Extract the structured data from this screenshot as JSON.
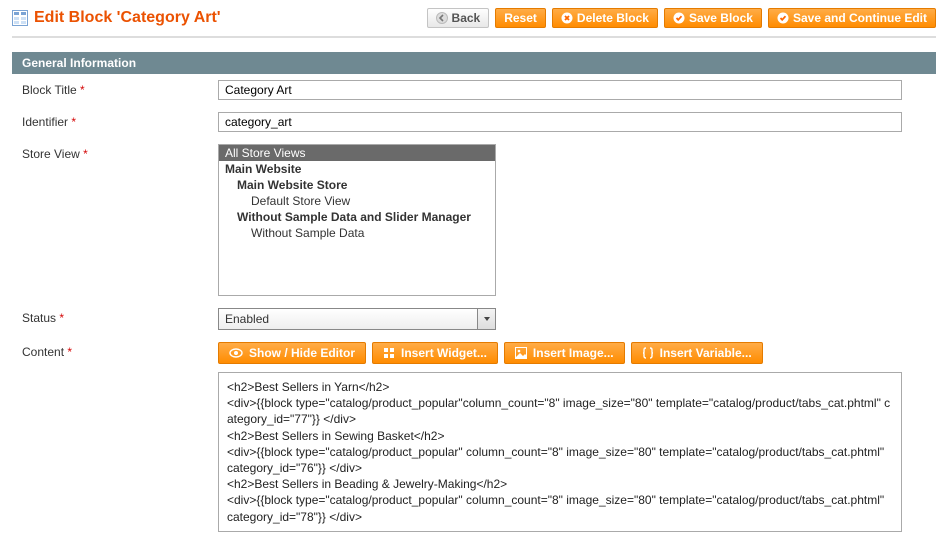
{
  "header": {
    "title": "Edit Block 'Category Art'",
    "buttons": {
      "back": "Back",
      "reset": "Reset",
      "delete": "Delete Block",
      "save": "Save Block",
      "save_continue": "Save and Continue Edit"
    }
  },
  "section": {
    "title": "General Information"
  },
  "fields": {
    "block_title": {
      "label": "Block Title",
      "value": "Category Art"
    },
    "identifier": {
      "label": "Identifier",
      "value": "category_art"
    },
    "store_view": {
      "label": "Store View",
      "options": {
        "all": "All Store Views",
        "main_website": "Main Website",
        "main_store": "Main Website Store",
        "default_view": "Default Store View",
        "no_sample_mgr": "Without Sample Data and Slider Manager",
        "no_sample": "Without Sample Data"
      }
    },
    "status": {
      "label": "Status",
      "value": "Enabled"
    },
    "content": {
      "label": "Content",
      "toolbar": {
        "toggle": "Show / Hide Editor",
        "widget": "Insert Widget...",
        "image": "Insert Image...",
        "variable": "Insert Variable..."
      },
      "lines": [
        "<h2>Best Sellers in  Yarn</h2>",
        "<div>{{block type=\"catalog/product_popular\"column_count=\"8\" image_size=\"80\"  template=\"catalog/product/tabs_cat.phtml\" category_id=\"77\"}} </div>",
        "<h2>Best Sellers in  Sewing Basket</h2>",
        "<div>{{block type=\"catalog/product_popular\" column_count=\"8\" image_size=\"80\" template=\"catalog/product/tabs_cat.phtml\" category_id=\"76\"}} </div>",
        "<h2>Best Sellers in  Beading & Jewelry-Making</h2>",
        "<div>{{block type=\"catalog/product_popular\" column_count=\"8\" image_size=\"80\" template=\"catalog/product/tabs_cat.phtml\" category_id=\"78\"}} </div>"
      ]
    }
  }
}
